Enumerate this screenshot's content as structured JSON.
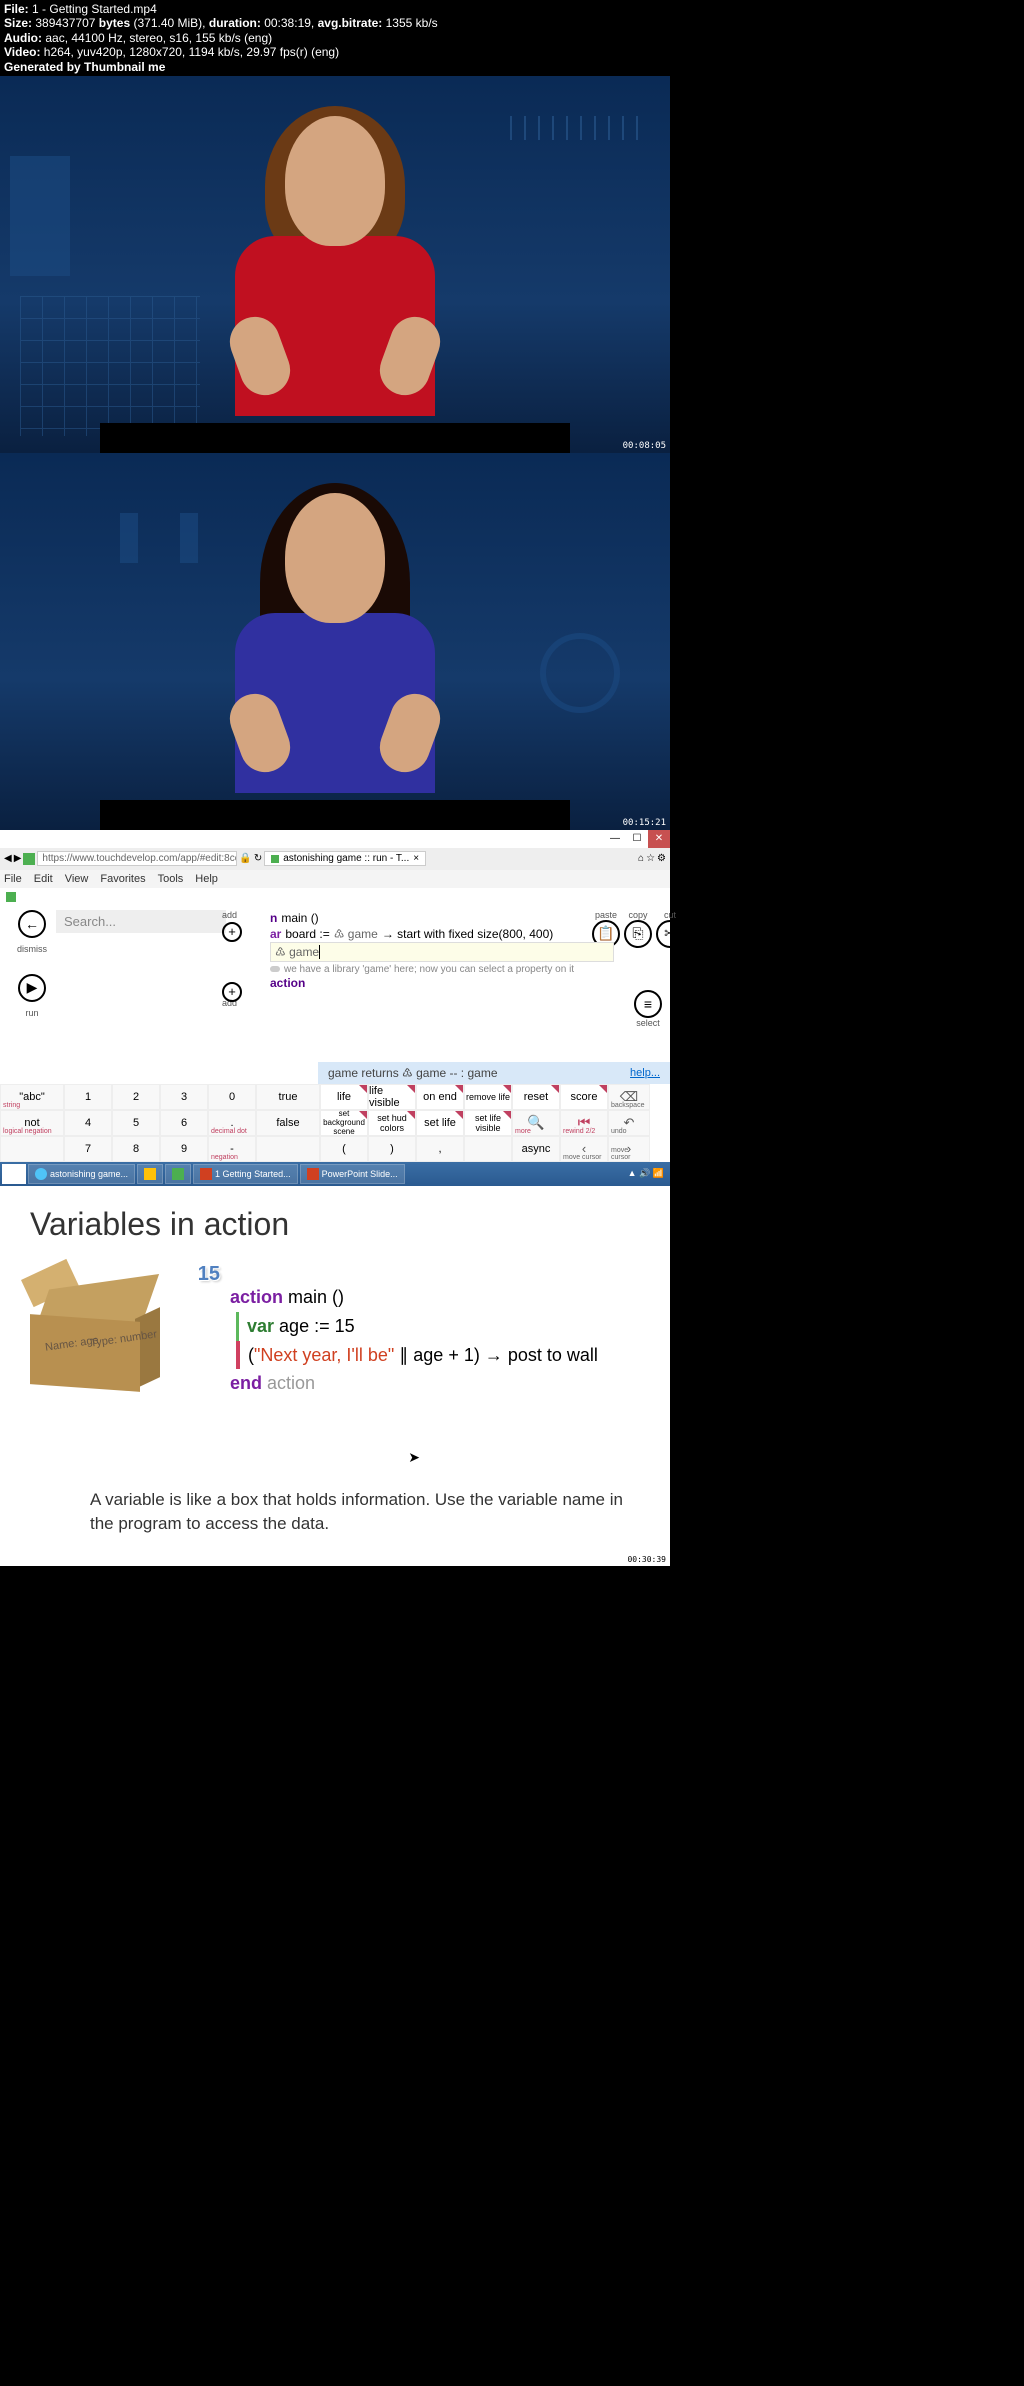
{
  "meta": {
    "file_label": "File:",
    "file_value": "1 - Getting Started.mp4",
    "size_label": "Size:",
    "size_bytes": "389437707",
    "size_unit": "bytes",
    "size_mib": "(371.40 MiB),",
    "duration_label": "duration:",
    "duration_value": "00:38:19,",
    "bitrate_label": "avg.bitrate:",
    "bitrate_value": "1355 kb/s",
    "audio_label": "Audio:",
    "audio_value": "aac, 44100 Hz, stereo, s16, 155 kb/s (eng)",
    "video_label": "Video:",
    "video_value": "h264, yuv420p, 1280x720, 1194 kb/s, 29.97 fps(r) (eng)",
    "generated": "Generated by Thumbnail me"
  },
  "frames": {
    "ts1": "00:08:05",
    "ts2": "00:15:21"
  },
  "browser": {
    "min": "—",
    "max": "☐",
    "close": "✕",
    "url": "https://www.touchdevelop.com/app/#edit:8cc50705-6e65-40fe-a",
    "tab_title": "astonishing game :: run - T...",
    "menu": [
      "File",
      "Edit",
      "View",
      "Favorites",
      "Tools",
      "Help"
    ]
  },
  "ide": {
    "back_glyph": "←",
    "dismiss": "dismiss",
    "play_glyph": "▶",
    "run": "run",
    "search_placeholder": "Search...",
    "add": "add",
    "plus": "+",
    "paste": "paste",
    "copy": "copy",
    "cut": "cut",
    "paste_glyph": "📋",
    "copy_glyph": "⎘",
    "cut_glyph": "✂",
    "select": "select",
    "select_glyph": "≡",
    "line1_kw": "n",
    "line1_name": "main ()",
    "line2_kw": "ar",
    "line2_name": "board :=",
    "line2_lib": "♳ game",
    "line2_rest": "→ start with fixed size(800, 400)",
    "cursor_lib": "♳ game",
    "hint": "we have a library 'game' here; now you can select a property on it",
    "line4_kw": "action"
  },
  "returns": {
    "text": "game returns ♳ game -- : game",
    "help": "help..."
  },
  "keypad": {
    "r1": [
      "\"abc\"",
      "1",
      "2",
      "3",
      "0",
      "true",
      "life",
      "life visible",
      "on end",
      "remove life",
      "reset",
      "score"
    ],
    "r1_icon": "⌫",
    "r1_icon_sub": "backspace",
    "r1_sub0": "string",
    "r2": [
      "not",
      "4",
      "5",
      "6",
      ".",
      "false",
      "set background scene",
      "set hud colors",
      "set life",
      "set life visible"
    ],
    "r2_search": "🔍",
    "r2_search_sub": "more",
    "r2_rewind": "⏮",
    "r2_rewind_sub": "rewind 2/2",
    "r2_undo": "↶",
    "r2_undo_sub": "undo",
    "r2_sub0": "logical negation",
    "r2_sub4": "decimal dot",
    "r3": [
      "",
      "7",
      "8",
      "9",
      "-",
      "",
      "(",
      ")",
      ",",
      "async"
    ],
    "r3_left": "‹",
    "r3_left_sub": "move cursor",
    "r3_right": "›",
    "r3_right_sub": "move cursor",
    "r3_sub4": "negation"
  },
  "taskbar": {
    "items": [
      "astonishing game...",
      "",
      "",
      "1 Getting Started...",
      "PowerPoint Slide..."
    ]
  },
  "slide": {
    "title": "Variables in action",
    "num": "15",
    "box_name": "Name: age",
    "box_type": "Type: number",
    "c1a": "action",
    "c1b": "main ()",
    "c2a": "var",
    "c2b": "age := 15",
    "c3a": "(",
    "c3b": "\"Next year, I'll be\"",
    "c3c": " ∥ age + 1) → post to wall",
    "c4a": "end",
    "c4b": "action",
    "footer": "A variable is like a box that holds information. Use the variable name in the program to access the data.",
    "ts": "00:30:39"
  }
}
